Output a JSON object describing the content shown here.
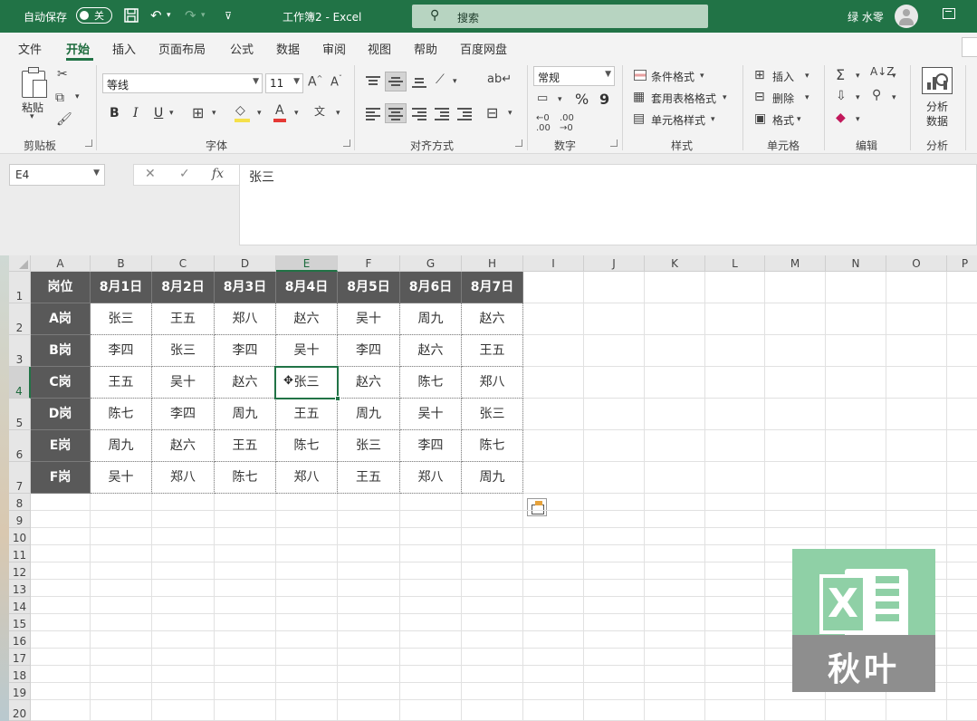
{
  "titlebar": {
    "autosave_label": "自动保存",
    "autosave_state": "关",
    "doc_title": "工作簿2 - Excel",
    "search_placeholder": "搜索",
    "user_name": "绿 水零"
  },
  "menu_tabs": [
    "文件",
    "开始",
    "插入",
    "页面布局",
    "公式",
    "数据",
    "审阅",
    "视图",
    "帮助",
    "百度网盘"
  ],
  "ribbon": {
    "clipboard": {
      "paste": "粘贴",
      "group": "剪贴板"
    },
    "font": {
      "name": "等线",
      "size": "11",
      "bold": "B",
      "italic": "I",
      "underline": "U",
      "group": "字体"
    },
    "alignment": {
      "group": "对齐方式"
    },
    "number": {
      "format": "常规",
      "percent": "%",
      "comma": "9",
      "group": "数字"
    },
    "styles": {
      "conditional": "条件格式",
      "table": "套用表格格式",
      "cell_styles": "单元格样式",
      "group": "样式"
    },
    "cells": {
      "insert": "插入",
      "delete": "删除",
      "format": "格式",
      "group": "单元格"
    },
    "editing": {
      "group": "编辑"
    },
    "analysis": {
      "button_line1": "分析",
      "button_line2": "数据",
      "group": "分析"
    }
  },
  "formula_bar": {
    "name_box": "E4",
    "fx": "fx",
    "content": "张三"
  },
  "sheet": {
    "column_headers": [
      "A",
      "B",
      "C",
      "D",
      "E",
      "F",
      "G",
      "H",
      "I",
      "J",
      "K",
      "L",
      "M",
      "N",
      "O",
      "P"
    ],
    "row_numbers": [
      "1",
      "2",
      "3",
      "4",
      "5",
      "6",
      "7",
      "8",
      "9",
      "10",
      "11",
      "12",
      "13",
      "14",
      "15",
      "16",
      "17",
      "18",
      "19",
      "20"
    ],
    "table": [
      [
        "岗位",
        "8月1日",
        "8月2日",
        "8月3日",
        "8月4日",
        "8月5日",
        "8月6日",
        "8月7日"
      ],
      [
        "A岗",
        "张三",
        "王五",
        "郑八",
        "赵六",
        "吴十",
        "周九",
        "赵六"
      ],
      [
        "B岗",
        "李四",
        "张三",
        "李四",
        "吴十",
        "李四",
        "赵六",
        "王五"
      ],
      [
        "C岗",
        "王五",
        "吴十",
        "赵六",
        "张三",
        "赵六",
        "陈七",
        "郑八"
      ],
      [
        "D岗",
        "陈七",
        "李四",
        "周九",
        "王五",
        "周九",
        "吴十",
        "张三"
      ],
      [
        "E岗",
        "周九",
        "赵六",
        "王五",
        "陈七",
        "张三",
        "李四",
        "陈七"
      ],
      [
        "F岗",
        "吴十",
        "郑八",
        "陈七",
        "郑八",
        "王五",
        "郑八",
        "周九"
      ]
    ],
    "selected_column": "E",
    "selected_row": "4"
  },
  "logo": {
    "letter": "X",
    "brand": "秋叶"
  }
}
